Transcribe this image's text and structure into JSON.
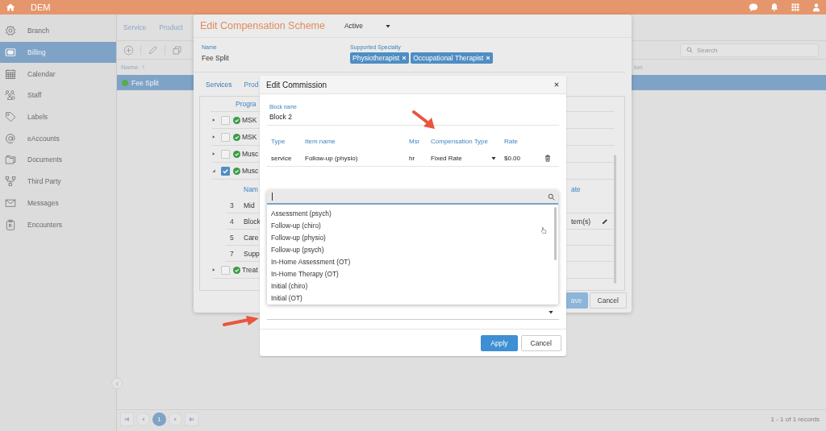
{
  "app_bar": {
    "title": "DEM"
  },
  "sidebar": {
    "items": [
      {
        "label": "Branch",
        "selected": false
      },
      {
        "label": "Billing",
        "selected": true
      },
      {
        "label": "Calendar",
        "selected": false
      },
      {
        "label": "Staff",
        "selected": false
      },
      {
        "label": "Labels",
        "selected": false
      },
      {
        "label": "eAccounts",
        "selected": false
      },
      {
        "label": "Documents",
        "selected": false
      },
      {
        "label": "Third Party",
        "selected": false
      },
      {
        "label": "Messages",
        "selected": false
      },
      {
        "label": "Encounters",
        "selected": false
      }
    ]
  },
  "list_panel": {
    "tabs": [
      {
        "label": "Service",
        "selected": false
      },
      {
        "label": "Product",
        "selected": false
      }
    ],
    "search": {
      "placeholder": "Search"
    },
    "columns": [
      {
        "label": "Name",
        "sort": "↑"
      },
      {
        "label": "ion"
      }
    ],
    "rows": [
      {
        "name": "Fee Split",
        "active": true,
        "selected": true
      }
    ],
    "pager": {
      "pages": [
        {
          "label": "1",
          "selected": true
        }
      ],
      "summary": "1 - 1 of 1 records"
    }
  },
  "scheme_dialog": {
    "title": "Edit Compensation Scheme",
    "status": "Active",
    "name_label": "Name",
    "name": "Fee Split",
    "specialty_label": "Supported Specialty",
    "specialties": [
      "Physiotherapist",
      "Occupational Therapist"
    ],
    "tabs": [
      {
        "label": "Services",
        "selected": true
      },
      {
        "label": "Prod",
        "selected": false
      }
    ],
    "tree_header": "Progra",
    "programs": [
      {
        "label": "MSK",
        "active": true,
        "checked": false,
        "expanded": false
      },
      {
        "label": "MSK",
        "active": true,
        "checked": false,
        "expanded": false
      },
      {
        "label": "Musc",
        "active": true,
        "checked": false,
        "expanded": false
      },
      {
        "label": "Musc",
        "active": true,
        "checked": true,
        "expanded": true,
        "item_columns": [
          "Nam",
          "ate"
        ],
        "items": [
          {
            "number": "3",
            "name": "Mid",
            "editable": false
          },
          {
            "number": "4",
            "name": "Block",
            "column_2": "tem(s)",
            "editable": true
          },
          {
            "number": "5",
            "name": "Care",
            "editable": false
          },
          {
            "number": "7",
            "name": "Supp",
            "editable": false
          }
        ]
      },
      {
        "label": "Treat",
        "active": true,
        "checked": false,
        "expanded": false
      }
    ],
    "buttons": [
      {
        "label": "ave",
        "kind": "primary"
      },
      {
        "label": "Cancel",
        "kind": "secondary"
      }
    ]
  },
  "commission_dialog": {
    "title": "Edit Commission",
    "block_label": "Block name",
    "block_name": "Block 2",
    "columns": [
      "Type",
      "Item name",
      "Msr",
      "Compensation Type",
      "Rate"
    ],
    "rows": [
      {
        "type": "service",
        "item": "Follow-up (physio)",
        "msr": "hr",
        "compensation_type": "Fixed Rate",
        "rate": "$0.00"
      }
    ],
    "dropdown": {
      "open": true,
      "options": [
        "Assessment (psych)",
        "Follow-up (chiro)",
        "Follow-up (physio)",
        "Follow-up (psych)",
        "In-Home Assessment (OT)",
        "In-Home Therapy (OT)",
        "Initial (chiro)",
        "Initial (OT)"
      ]
    },
    "buttons": [
      {
        "label": "Apply",
        "kind": "primary"
      },
      {
        "label": "Cancel",
        "kind": "secondary"
      }
    ]
  }
}
